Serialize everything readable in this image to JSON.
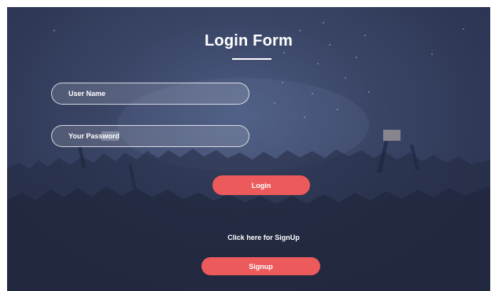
{
  "form": {
    "title": "Login Form",
    "username_placeholder": "User Name",
    "password_placeholder": "Your Password",
    "login_label": "Login",
    "signup_prompt": "Click here for SignUp",
    "signup_label": "Signup"
  },
  "colors": {
    "background": "#333c5c",
    "accent": "#ec5a5c",
    "text": "#ffffff"
  },
  "icons": {
    "background": "concert-crowd-background"
  }
}
